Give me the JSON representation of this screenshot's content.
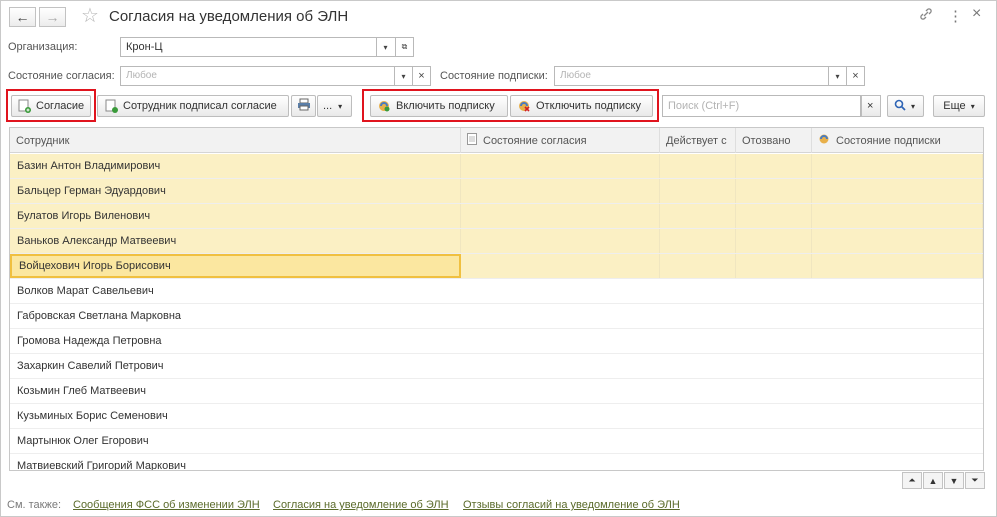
{
  "window": {
    "title": "Согласия на уведомления об ЭЛН",
    "back_icon": "←",
    "forward_icon": "→",
    "star_icon": "☆",
    "link_icon": "🔗",
    "more_icon": "⋮",
    "close_icon": "×"
  },
  "filters": {
    "organization_label": "Организация:",
    "organization_value": "Крон-Ц",
    "consent_state_label": "Состояние согласия:",
    "consent_state_placeholder": "Любое",
    "subscription_state_label": "Состояние подписки:",
    "subscription_state_placeholder": "Любое"
  },
  "toolbar": {
    "consent_label": "Согласие",
    "employee_signed_label": "Сотрудник подписал согласие",
    "more_dots": "...",
    "enable_subscription_label": "Включить подписку",
    "disable_subscription_label": "Отключить подписку",
    "search_placeholder": "Поиск (Ctrl+F)",
    "more_label": "Еще"
  },
  "table": {
    "columns": [
      "Сотрудник",
      "Состояние согласия",
      "Действует с",
      "Отозвано",
      "Состояние подписки"
    ],
    "rows": [
      {
        "name": "Базин Антон Владимирович",
        "highlighted": true
      },
      {
        "name": "Бальцер Герман Эдуардович",
        "highlighted": true
      },
      {
        "name": "Булатов Игорь Виленович",
        "highlighted": true
      },
      {
        "name": "Ваньков Александр Матвеевич",
        "highlighted": true
      },
      {
        "name": "Войцехович Игорь Борисович",
        "highlighted": true,
        "selected": true
      },
      {
        "name": "Волков Марат Савельевич",
        "highlighted": false
      },
      {
        "name": "Габровская Светлана Марковна",
        "highlighted": false
      },
      {
        "name": "Громова Надежда Петровна",
        "highlighted": false
      },
      {
        "name": "Захаркин Савелий Петрович",
        "highlighted": false
      },
      {
        "name": "Козьмин Глеб Матвеевич",
        "highlighted": false
      },
      {
        "name": "Кузьминых Борис Семенович",
        "highlighted": false
      },
      {
        "name": "Мартынюк Олег Егорович",
        "highlighted": false
      },
      {
        "name": "Матвиевский Григорий Маркович",
        "highlighted": false
      }
    ]
  },
  "footer": {
    "see_also": "См. также:",
    "links": [
      "Сообщения ФСС об изменении ЭЛН",
      "Согласия на уведомление об ЭЛН",
      "Отзывы согласий на уведомление об ЭЛН"
    ]
  },
  "colors": {
    "highlight_row": "#fbf0c4",
    "selected_cell": "#fbe7a0",
    "annotation_red": "#e0141e",
    "link": "#5a6a2a"
  }
}
